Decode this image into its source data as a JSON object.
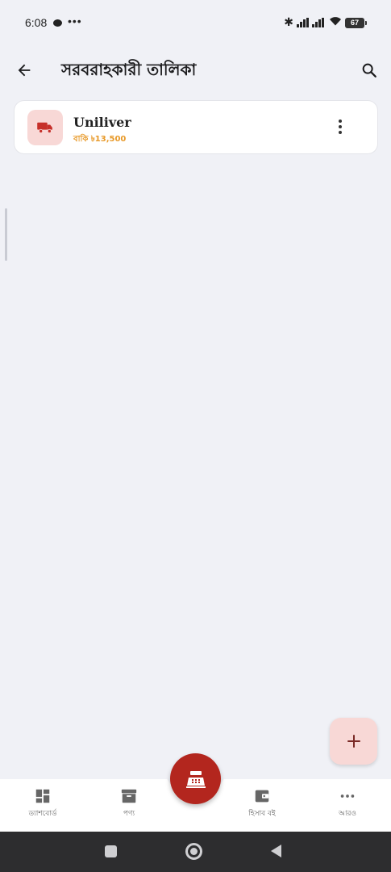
{
  "status_bar": {
    "time": "6:08",
    "more_dots": "•••",
    "battery": "67",
    "icons": [
      "chat-bubble-icon",
      "bluetooth-icon",
      "signal-icon",
      "signal-icon",
      "wifi-icon",
      "battery-icon"
    ]
  },
  "app_bar": {
    "title": "সরবরাহকারী তালিকা",
    "back_icon": "arrow-left-icon",
    "search_icon": "search-icon"
  },
  "suppliers": [
    {
      "name": "Uniliver",
      "due_text": "বাকি ৳13,500",
      "icon": "truck-icon"
    }
  ],
  "fab": {
    "icon": "plus-icon"
  },
  "bottom_nav": {
    "items": [
      {
        "label": "ড্যাশবোর্ড",
        "icon": "dashboard-icon"
      },
      {
        "label": "পণ্য",
        "icon": "archive-box-icon"
      },
      {
        "label": "হিসাব বই",
        "icon": "wallet-icon"
      },
      {
        "label": "আরও",
        "icon": "more-horizontal-icon"
      }
    ],
    "center_icon": "cash-register-icon"
  },
  "colors": {
    "accent": "#b3261e",
    "accent_light": "#f8d8d6",
    "due_orange": "#e89a2a",
    "background": "#f0f1f6"
  }
}
